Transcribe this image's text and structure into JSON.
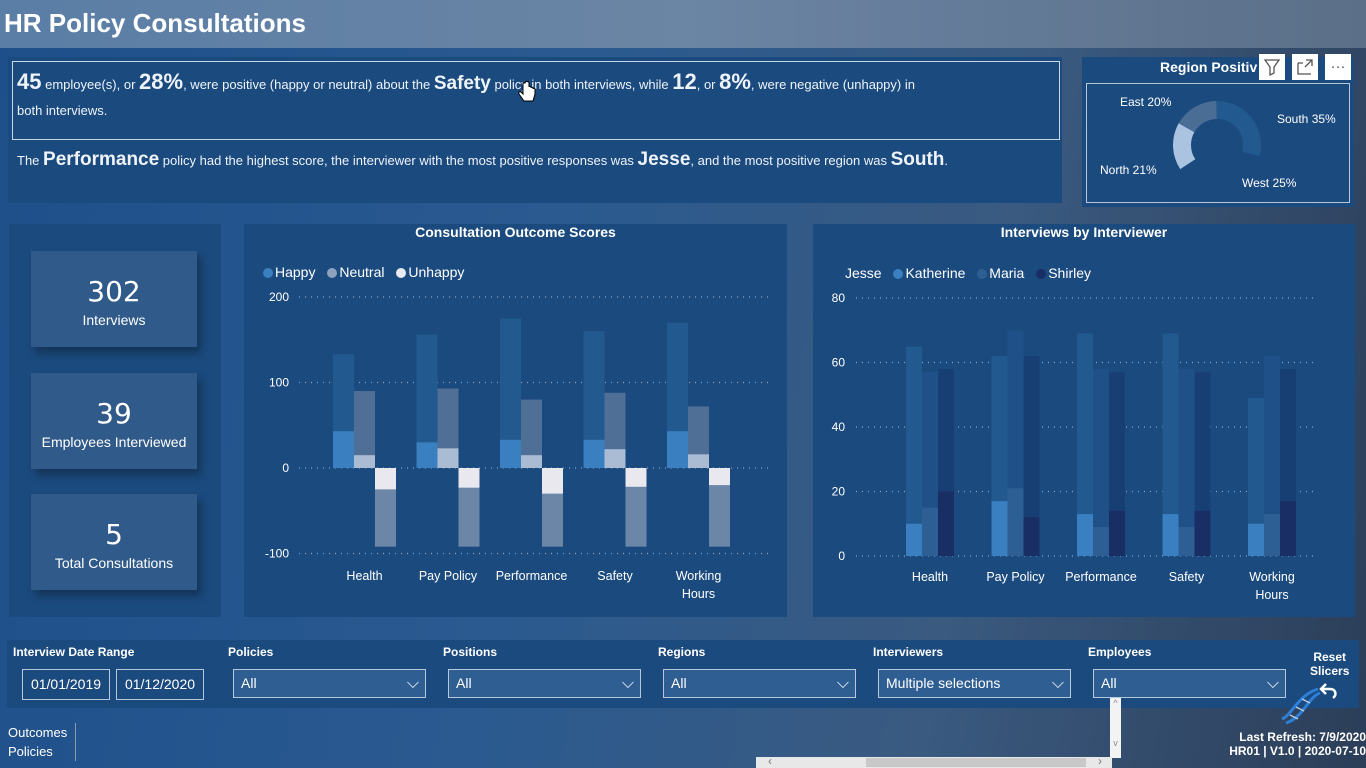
{
  "title": "HR Policy Consultations",
  "summary": {
    "line1": {
      "count_pos": "45",
      "t1": " employee(s), or ",
      "pct_pos": "28%",
      "t2": ", were positive (happy or neutral) about the ",
      "policy": "Safety",
      "t3": " policy in both interviews, while ",
      "count_neg": "12",
      "t4": ", or ",
      "pct_neg": "8%",
      "t5": ", were negative (unhappy) in",
      "t6": "both interviews."
    },
    "line2": {
      "t1": "The ",
      "top_policy": "Performance",
      "t2": " policy had the highest score, the interviewer with the most positive responses was ",
      "top_interviewer": "Jesse",
      "t3": ", and the most positive region was ",
      "top_region": "South",
      "t4": "."
    }
  },
  "region_chart": {
    "title": "Region Positiv",
    "icons": {
      "filter": "filter-icon",
      "focus": "focus-mode-icon",
      "more": "more-options-icon"
    }
  },
  "kpis": [
    {
      "value": "302",
      "label": "Interviews"
    },
    {
      "value": "39",
      "label": "Employees Interviewed"
    },
    {
      "value": "5",
      "label": "Total Consultations"
    }
  ],
  "chart_data": [
    {
      "type": "pie",
      "title": "Region Positive",
      "variant": "donut",
      "slices": [
        {
          "label": "South",
          "value": 35,
          "display": "South 35%",
          "color": "#22598f"
        },
        {
          "label": "West",
          "value": 25,
          "display": "West 25%",
          "color": "#1b4a7e"
        },
        {
          "label": "North",
          "value": 21,
          "display": "North 21%",
          "color": "#a9c3e0"
        },
        {
          "label": "East",
          "value": 20,
          "display": "East 20%",
          "color": "#4a6d96"
        }
      ]
    },
    {
      "type": "bar",
      "title": "Consultation Outcome Scores",
      "categories": [
        "Health",
        "Pay Policy",
        "Performance",
        "Safety",
        "Working Hours"
      ],
      "category_lines": [
        [
          "Health"
        ],
        [
          "Pay Policy"
        ],
        [
          "Performance"
        ],
        [
          "Safety"
        ],
        [
          "Working",
          "Hours"
        ]
      ],
      "legend": [
        {
          "name": "Happy",
          "color": "#3a7fc0"
        },
        {
          "name": "Neutral",
          "color": "#8da3bd"
        },
        {
          "name": "Unhappy",
          "color": "#e8ecf2"
        }
      ],
      "series": [
        {
          "name": "Happy",
          "values": [
            133,
            156,
            175,
            160,
            170
          ],
          "both_interviews": [
            43,
            30,
            33,
            33,
            43
          ],
          "colors": [
            "#22598f",
            "#3a7fc0"
          ]
        },
        {
          "name": "Neutral",
          "values": [
            90,
            93,
            80,
            88,
            72
          ],
          "both_interviews": [
            15,
            23,
            15,
            22,
            16
          ],
          "colors": [
            "#4f6f96",
            "#a9bcd4"
          ]
        },
        {
          "name": "Unhappy",
          "values": [
            -92,
            -92,
            -92,
            -92,
            -92
          ],
          "both_interviews": [
            -25,
            -23,
            -30,
            -22,
            -20
          ],
          "colors": [
            "#6c86a8",
            "#e8e8ee"
          ]
        }
      ],
      "ylim": [
        -100,
        200
      ],
      "yticks": [
        200,
        100,
        0,
        -100
      ],
      "xlabel": "",
      "ylabel": "",
      "grid": true,
      "legend_position": "top-left"
    },
    {
      "type": "bar",
      "title": "Interviews by Interviewer",
      "categories": [
        "Health",
        "Pay Policy",
        "Performance",
        "Safety",
        "Working Hours"
      ],
      "category_lines": [
        [
          "Health"
        ],
        [
          "Pay Policy"
        ],
        [
          "Performance"
        ],
        [
          "Safety"
        ],
        [
          "Working",
          "Hours"
        ]
      ],
      "legend": [
        {
          "name": "Jesse",
          "color": "#1b4a7e"
        },
        {
          "name": "Katherine",
          "color": "#3a7fc0"
        },
        {
          "name": "Maria",
          "color": "#2d5f95"
        },
        {
          "name": "Shirley",
          "color": "#1a2e66"
        }
      ],
      "series": [
        {
          "name": "Katherine",
          "values": [
            65,
            62,
            69,
            69,
            49
          ],
          "inner": [
            10,
            17,
            13,
            13,
            10
          ],
          "colors": [
            "#22598f",
            "#3a7fc0"
          ]
        },
        {
          "name": "Maria",
          "values": [
            57,
            70,
            58,
            58,
            62
          ],
          "inner": [
            15,
            21,
            9,
            9,
            13
          ],
          "colors": [
            "#1f5088",
            "#2d5f95"
          ]
        },
        {
          "name": "Shirley",
          "values": [
            58,
            62,
            57,
            57,
            58
          ],
          "inner": [
            20,
            12,
            14,
            14,
            17
          ],
          "colors": [
            "#183f74",
            "#1a2e66"
          ]
        }
      ],
      "ylim": [
        0,
        80
      ],
      "yticks": [
        80,
        60,
        40,
        20,
        0
      ],
      "xlabel": "",
      "ylabel": "",
      "grid": true,
      "legend_position": "top-left"
    }
  ],
  "slicers": {
    "date_range": {
      "label": "Interview Date Range",
      "start": "01/01/2019",
      "end": "01/12/2020"
    },
    "items": [
      {
        "label": "Policies",
        "value": "All"
      },
      {
        "label": "Positions",
        "value": "All"
      },
      {
        "label": "Regions",
        "value": "All"
      },
      {
        "label": "Interviewers",
        "value": "Multiple selections"
      },
      {
        "label": "Employees",
        "value": "All"
      }
    ],
    "reset": {
      "line1": "Reset",
      "line2": "Slicers"
    }
  },
  "nav": {
    "items": [
      "Outcomes",
      "Policies"
    ]
  },
  "footer": {
    "refresh": "Last Refresh: 7/9/2020",
    "version": "HR01 | V1.0 | 2020-07-10"
  },
  "scroll": {
    "left": "‹",
    "right": "›",
    "up": "^",
    "down": "v"
  }
}
